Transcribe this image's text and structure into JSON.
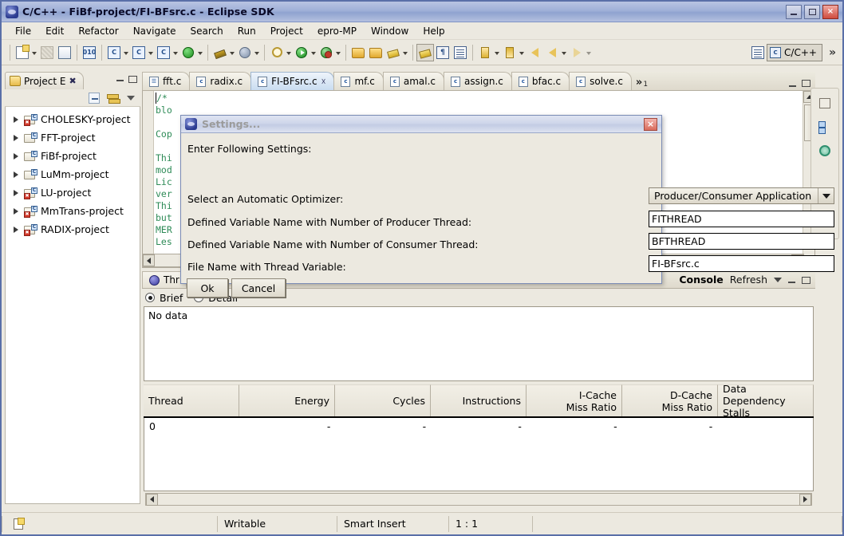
{
  "window": {
    "title": "C/C++ - FiBf-project/FI-BFsrc.c - Eclipse SDK",
    "minimize_label": "Minimize",
    "maximize_label": "Maximize",
    "close_label": "×"
  },
  "menubar": {
    "items": [
      {
        "label": "File",
        "mnemonic": "F"
      },
      {
        "label": "Edit",
        "mnemonic": "E"
      },
      {
        "label": "Refactor",
        "mnemonic": "t"
      },
      {
        "label": "Navigate",
        "mnemonic": "N"
      },
      {
        "label": "Search",
        "mnemonic": "a"
      },
      {
        "label": "Run",
        "mnemonic": "R"
      },
      {
        "label": "Project",
        "mnemonic": "P"
      },
      {
        "label": "epro-MP",
        "mnemonic": ""
      },
      {
        "label": "Window",
        "mnemonic": "W"
      },
      {
        "label": "Help",
        "mnemonic": "H"
      }
    ]
  },
  "toolbar": {
    "icons": [
      "new-wizard-icon",
      "save-icon",
      "print-icon",
      "build-binary-icon",
      "new-c-class-icon",
      "new-c-project-icon",
      "new-c-file-icon",
      "refresh-icon",
      "build-hammer-icon",
      "globe-icon",
      "debug-icon",
      "run-icon",
      "profile-icon",
      "open-folder-icon",
      "open-folder-alt-icon",
      "search-icon",
      "toggle-markoccurrences-icon",
      "show-whitespace-icon",
      "block-selection-icon",
      "next-annotation-icon",
      "previous-annotation-icon",
      "back-icon",
      "forward-icon",
      "open-perspective-icon"
    ],
    "perspective_label": "C/C++",
    "overflow_label": "»"
  },
  "project_explorer": {
    "tab_label": "Project E",
    "tab_close": "✖",
    "toolbar_icons": [
      "collapse-all-icon",
      "link-with-editor-icon",
      "view-menu-icon"
    ],
    "items": [
      {
        "label": "CHOLESKY-project",
        "has_error": true
      },
      {
        "label": "FFT-project",
        "has_error": false
      },
      {
        "label": "FiBf-project",
        "has_error": false
      },
      {
        "label": "LuMm-project",
        "has_error": false
      },
      {
        "label": "LU-project",
        "has_error": true
      },
      {
        "label": "MmTrans-project",
        "has_error": true
      },
      {
        "label": "RADIX-project",
        "has_error": true
      }
    ]
  },
  "editor": {
    "tabs": [
      {
        "label": "fft.c",
        "active": false,
        "closable": false
      },
      {
        "label": "radix.c",
        "active": false,
        "closable": false
      },
      {
        "label": "FI-BFsrc.c",
        "active": true,
        "closable": true
      },
      {
        "label": "mf.c",
        "active": false,
        "closable": false
      },
      {
        "label": "amal.c",
        "active": false,
        "closable": false
      },
      {
        "label": "assign.c",
        "active": false,
        "closable": false
      },
      {
        "label": "bfac.c",
        "active": false,
        "closable": false
      },
      {
        "label": "solve.c",
        "active": false,
        "closable": false
      }
    ],
    "overflow_indicator": "»",
    "overflow_count": "1",
    "code_lines": [
      "/*",
      "blo",
      "",
      "Cop",
      "",
      "Thi",
      "mod",
      "Lic",
      "ver",
      "Thi",
      "but",
      "MER",
      "Les"
    ]
  },
  "fast_view": {
    "icons": [
      "restore-view-icon",
      "outline-view-icon",
      "progress-view-icon"
    ]
  },
  "bottom_panel": {
    "thread_tab_label": "Thr",
    "console_tab_label": "Console",
    "refresh_label": "Refresh",
    "view_menu_icon": "view-menu-icon",
    "minimize_icon": "minimize-icon",
    "maximize_icon": "maximize-icon",
    "radio_options": [
      {
        "label": "Brief",
        "selected": true
      },
      {
        "label": "Detail",
        "selected": false
      }
    ],
    "text_content": "No data",
    "table": {
      "columns": [
        {
          "label": "Thread",
          "align": "l",
          "width": 125
        },
        {
          "label": "Energy",
          "align": "r",
          "width": 125
        },
        {
          "label": "Cycles",
          "align": "r",
          "width": 125
        },
        {
          "label": "Instructions",
          "align": "r",
          "width": 125
        },
        {
          "label": "I-Cache\nMiss Ratio",
          "align": "r",
          "width": 125
        },
        {
          "label": "D-Cache\nMiss Ratio",
          "align": "r",
          "width": 125
        },
        {
          "label": "Data Dependency\nStalls",
          "align": "l",
          "width": 125
        }
      ],
      "rows": [
        [
          "0",
          "-",
          "-",
          "-",
          "-",
          "-",
          ""
        ]
      ]
    }
  },
  "statusbar": {
    "icon": "editor-state-icon",
    "writable": "Writable",
    "insert_mode": "Smart Insert",
    "position": "1 : 1"
  },
  "dialog": {
    "title": "Settings...",
    "close_label": "×",
    "intro": "Enter Following Settings:",
    "rows": [
      {
        "label": "Select an Automatic Optimizer:",
        "type": "combo",
        "value": "Producer/Consumer Application"
      },
      {
        "label": "Defined Variable Name with Number of Producer Thread:",
        "type": "text",
        "value": "FITHREAD"
      },
      {
        "label": "Defined Variable Name with Number of Consumer Thread:",
        "type": "text",
        "value": "BFTHREAD"
      },
      {
        "label": "File Name with Thread Variable:",
        "type": "text",
        "value": "FI-BFsrc.c"
      }
    ],
    "ok_label": "Ok",
    "cancel_label": "Cancel"
  },
  "colors": {
    "window_bg": "#ece9e0",
    "title_accent": "#9fb0d8",
    "active_tab": "#c9dcf0",
    "code_comment": "#2e8b57",
    "error_badge": "#d33a2c"
  }
}
